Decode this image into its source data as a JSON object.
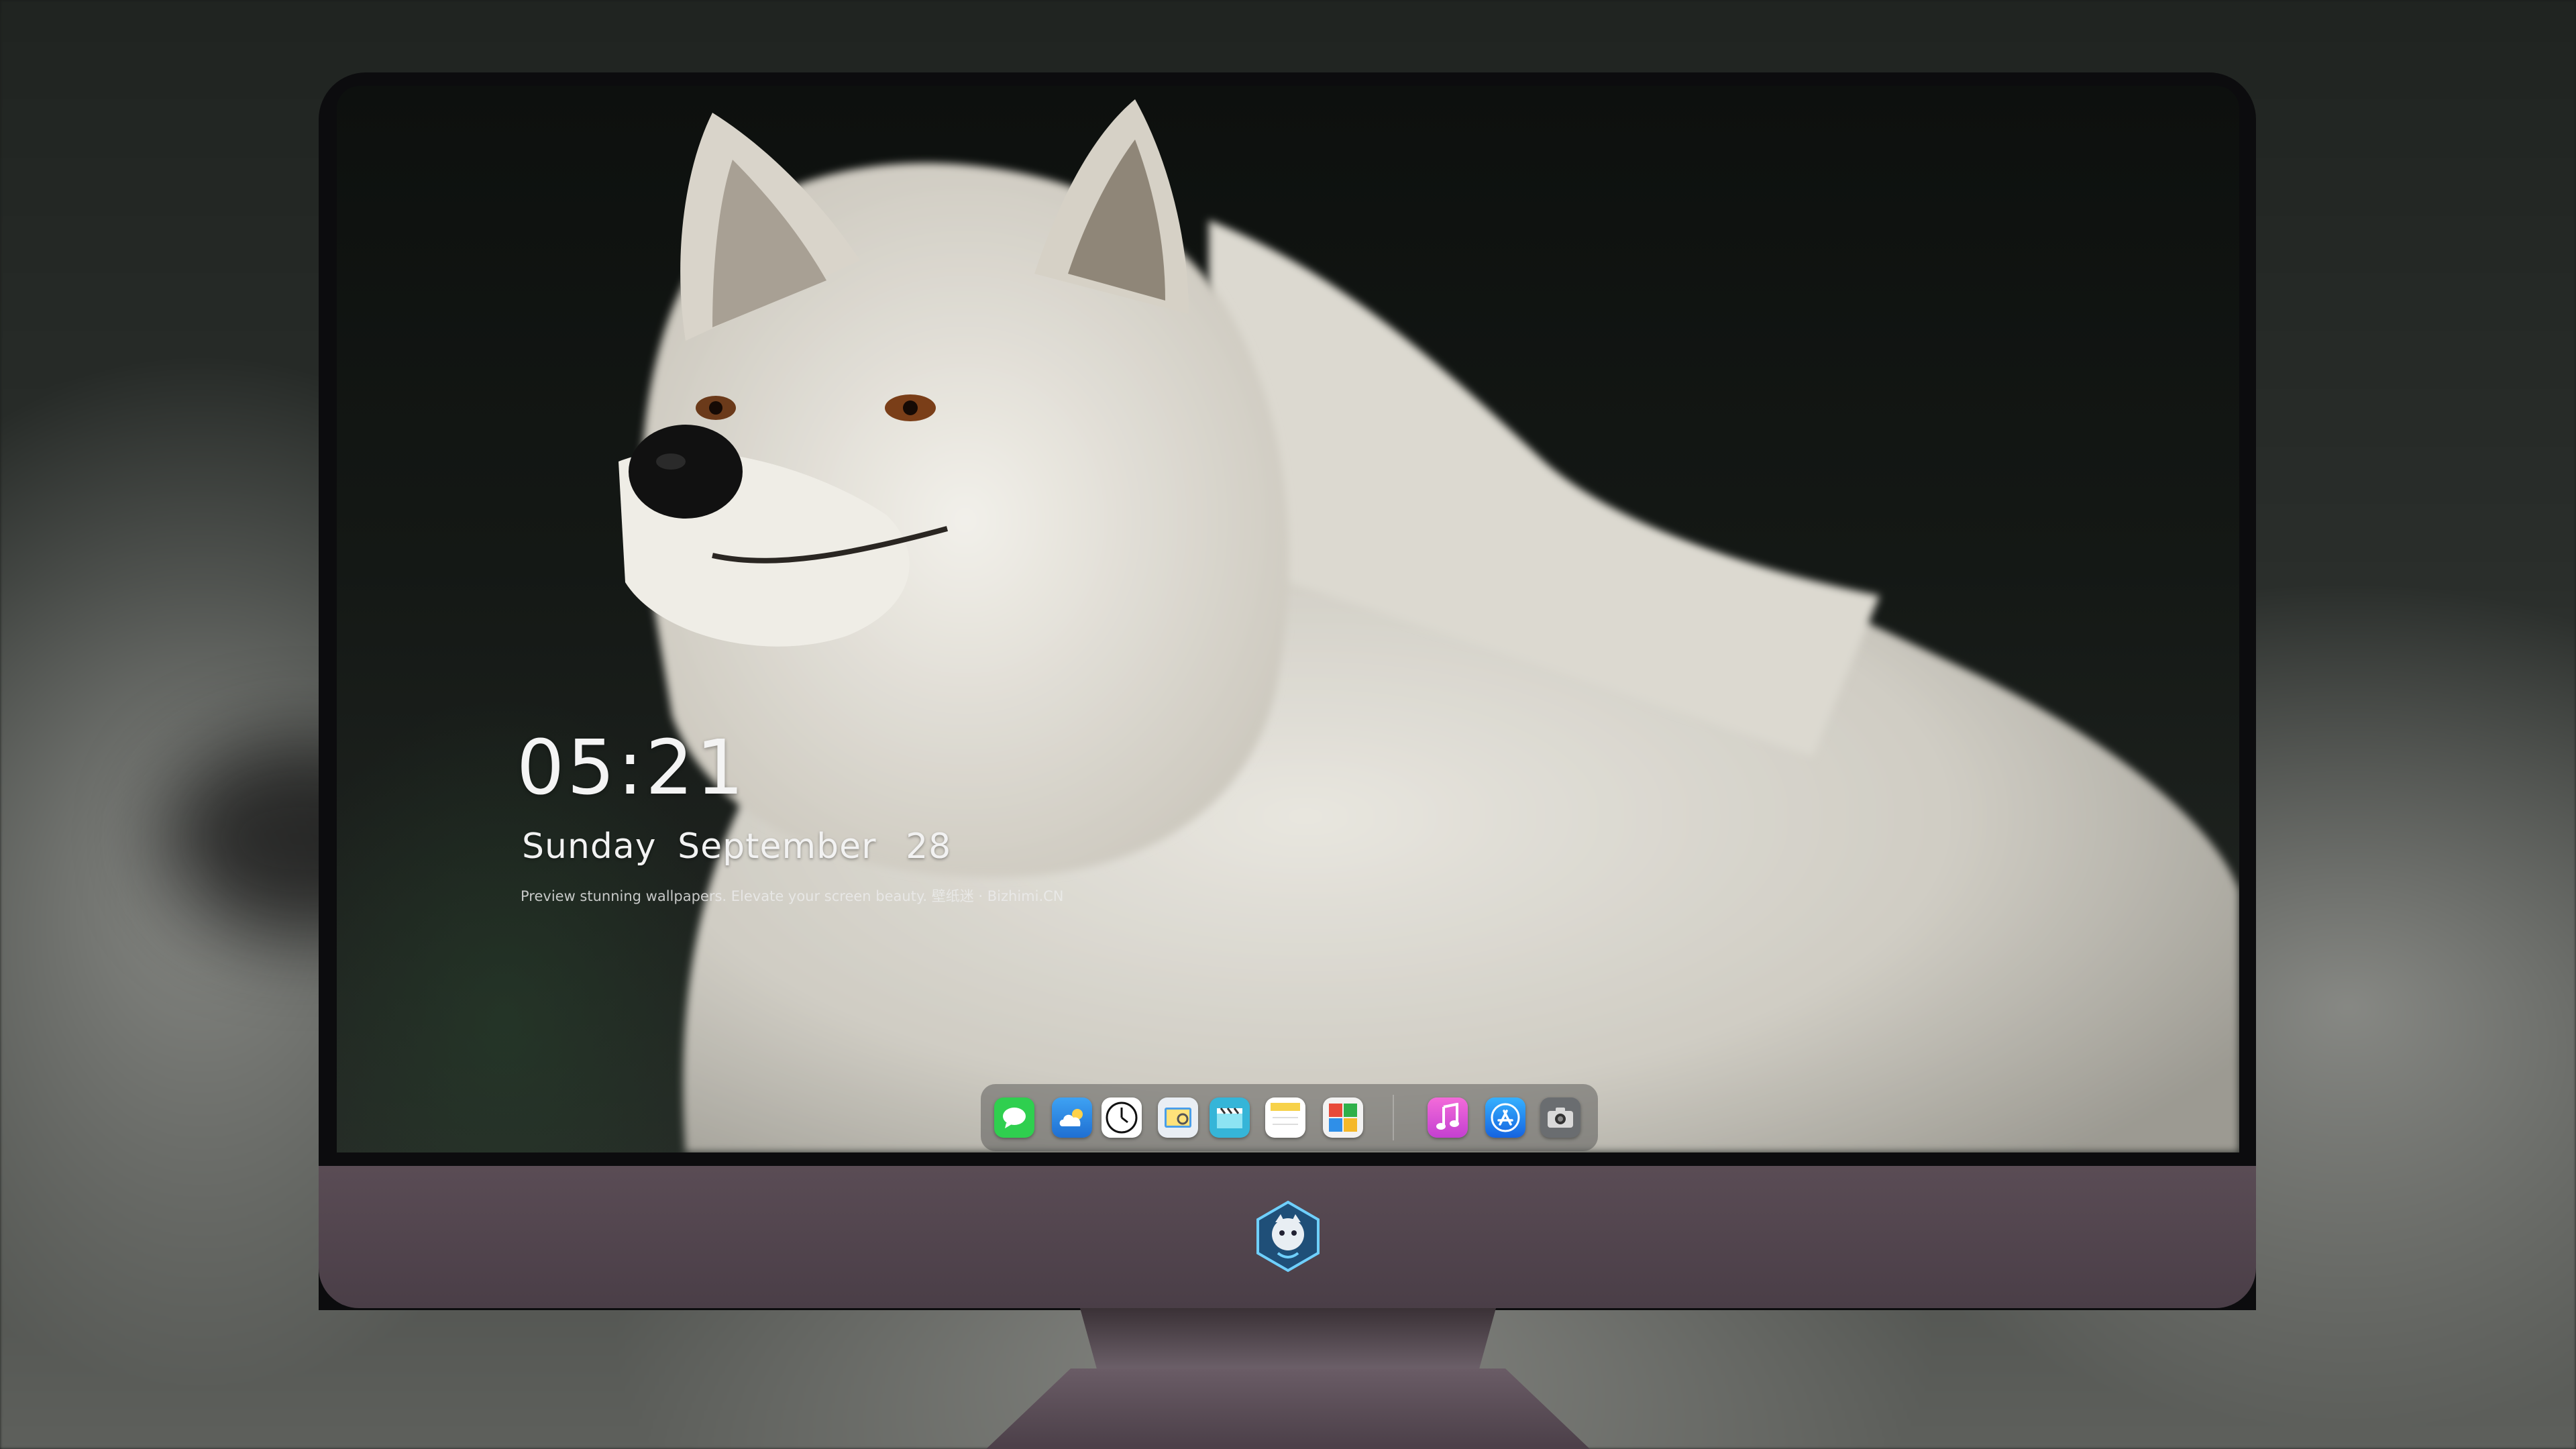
{
  "lockscreen": {
    "time": "05:21",
    "weekday": "Sunday",
    "month": "September",
    "day": "28",
    "tagline": "Preview stunning wallpapers. Elevate your screen beauty.  壁纸迷 · Bizhimi.CN"
  },
  "dock": {
    "apps": [
      {
        "name": "messages",
        "icon": "speech-bubble-icon",
        "color": "#2fcf4f"
      },
      {
        "name": "weather",
        "icon": "cloud-icon",
        "color": "#2f8fe8"
      },
      {
        "name": "clock",
        "icon": "clock-icon",
        "color": "#ffffff"
      },
      {
        "name": "preview",
        "icon": "photo-viewer-icon",
        "color": "#4a9ee8"
      },
      {
        "name": "video",
        "icon": "clapperboard-icon",
        "color": "#35b5d8"
      },
      {
        "name": "notes",
        "icon": "notes-icon",
        "color": "#f7d24a"
      },
      {
        "name": "photo-booth",
        "icon": "photo-booth-icon",
        "color": "#e84a3a"
      },
      {
        "name": "music",
        "icon": "music-note-icon",
        "color": "#e24fd8"
      },
      {
        "name": "app-store",
        "icon": "app-store-icon",
        "color": "#1f8ff0"
      },
      {
        "name": "camera",
        "icon": "camera-icon",
        "color": "#6a6d70"
      }
    ]
  }
}
